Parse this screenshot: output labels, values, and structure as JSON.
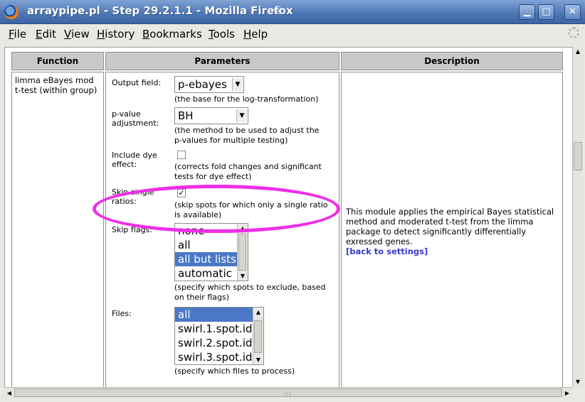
{
  "window": {
    "title": "arraypipe.pl - Step 29.2.1.1 - Mozilla Firefox",
    "controls": [
      "minimize",
      "maximize",
      "close"
    ]
  },
  "menu": {
    "items": [
      {
        "label": "File",
        "key": "F",
        "rest": "ile"
      },
      {
        "label": "Edit",
        "key": "E",
        "rest": "dit"
      },
      {
        "label": "View",
        "key": "V",
        "rest": "iew"
      },
      {
        "label": "History",
        "key": "H",
        "rest": "istory"
      },
      {
        "label": "Bookmarks",
        "key": "B",
        "rest": "ookmarks"
      },
      {
        "label": "Tools",
        "key": "T",
        "rest": "ools"
      },
      {
        "label": "Help",
        "key": "H",
        "rest": "elp"
      }
    ]
  },
  "table": {
    "headers": {
      "function": "Function",
      "parameters": "Parameters",
      "description": "Description"
    },
    "function_name": "limma eBayes mod t-test (within group)",
    "params": {
      "output_field": {
        "label": "Output field:",
        "value": "p-ebayes",
        "help": "(the base for the log-transformation)"
      },
      "pvalue_adjustment": {
        "label": "p-value adjustment:",
        "value": "BH",
        "help": "(the method to be used to adjust the p-values for multiple testing)"
      },
      "include_dye": {
        "label": "Include dye effect:",
        "checked": false,
        "help": "(corrects fold changes and significant tests for dye effect)"
      },
      "skip_single": {
        "label": "Skip single ratios:",
        "checked": true,
        "help": "(skip spots for which only a single ratio is available)"
      },
      "skip_flags": {
        "label": "Skip flags:",
        "options": [
          {
            "text": "none",
            "selected": false
          },
          {
            "text": "all",
            "selected": false
          },
          {
            "text": "all but lists",
            "selected": true
          },
          {
            "text": "automatic",
            "selected": false
          }
        ],
        "help": "(specify which spots to exclude, based on their flags)"
      },
      "files": {
        "label": "Files:",
        "options": [
          {
            "text": "all",
            "selected": true
          },
          {
            "text": "swirl.1.spot.id",
            "selected": false
          },
          {
            "text": "swirl.2.spot.id",
            "selected": false
          },
          {
            "text": "swirl.3.spot.id",
            "selected": false
          }
        ],
        "help": "(specify which files to process)"
      }
    },
    "description": {
      "text": "This module applies the empirical Bayes statistical method and moderated t-test from the limma package to detect significantly differentially exressed genes.",
      "link": "[back to settings]"
    }
  },
  "colors": {
    "annotation_ellipse": "#ee2ee8",
    "selection": "#4a78c6",
    "link": "#3a3acf",
    "header_bg": "#c9c9c9"
  }
}
